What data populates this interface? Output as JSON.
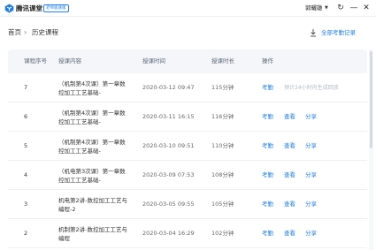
{
  "titlebar": {
    "app_name": "腾讯课堂",
    "edition": "老师极速版",
    "user_name": "郭耀雄",
    "caret": "▼",
    "refresh_glyph": "↻",
    "minimize_glyph": "—",
    "close_glyph": "✕",
    "brand_color": "#1f7ee8"
  },
  "breadcrumb": {
    "home": "首页",
    "separator": "›",
    "current": "历史课程"
  },
  "toolbar": {
    "all_records_label": "全部考勤记录",
    "download_icon": "download-icon"
  },
  "table": {
    "columns": {
      "seq": "课程序号",
      "content": "授课内容",
      "time": "授课时间",
      "duration": "授课时长",
      "actions": "操作"
    },
    "rows": [
      {
        "seq": "7",
        "title": "（机制第4次课）第一章数控加工工艺基础-",
        "time": "2020-03-12 09:47",
        "duration": "115分钟",
        "attendance": "考勤",
        "view": "",
        "share": "",
        "note": "预计24小时内生成回放"
      },
      {
        "seq": "6",
        "title": "（机制第4次课）第一章数控加工工艺基础-",
        "time": "2020-03-11 16:15",
        "duration": "116分钟",
        "attendance": "考勤",
        "view": "查看",
        "share": "分享",
        "note": ""
      },
      {
        "seq": "5",
        "title": "（机制第4次课）第一章数控加工工艺基础-",
        "time": "2020-03-10 09:51",
        "duration": "110分钟",
        "attendance": "考勤",
        "view": "查看",
        "share": "分享",
        "note": ""
      },
      {
        "seq": "4",
        "title": "（机电第3次课）第一章数控加工工艺基础-",
        "time": "2020-03-09 07:53",
        "duration": "108分钟",
        "attendance": "考勤",
        "view": "查看",
        "share": "分享",
        "note": ""
      },
      {
        "seq": "3",
        "title": "机电第2讲-数控加工工艺与编程-2",
        "time": "2020-03-05 09:55",
        "duration": "105分钟",
        "attendance": "考勤",
        "view": "查看",
        "share": "分享",
        "note": ""
      },
      {
        "seq": "2",
        "title": "机制第2讲-数控加工工艺与编程",
        "time": "2020-03-04 16:29",
        "duration": "102分钟",
        "attendance": "考勤",
        "view": "查看",
        "share": "分享",
        "note": ""
      }
    ]
  }
}
